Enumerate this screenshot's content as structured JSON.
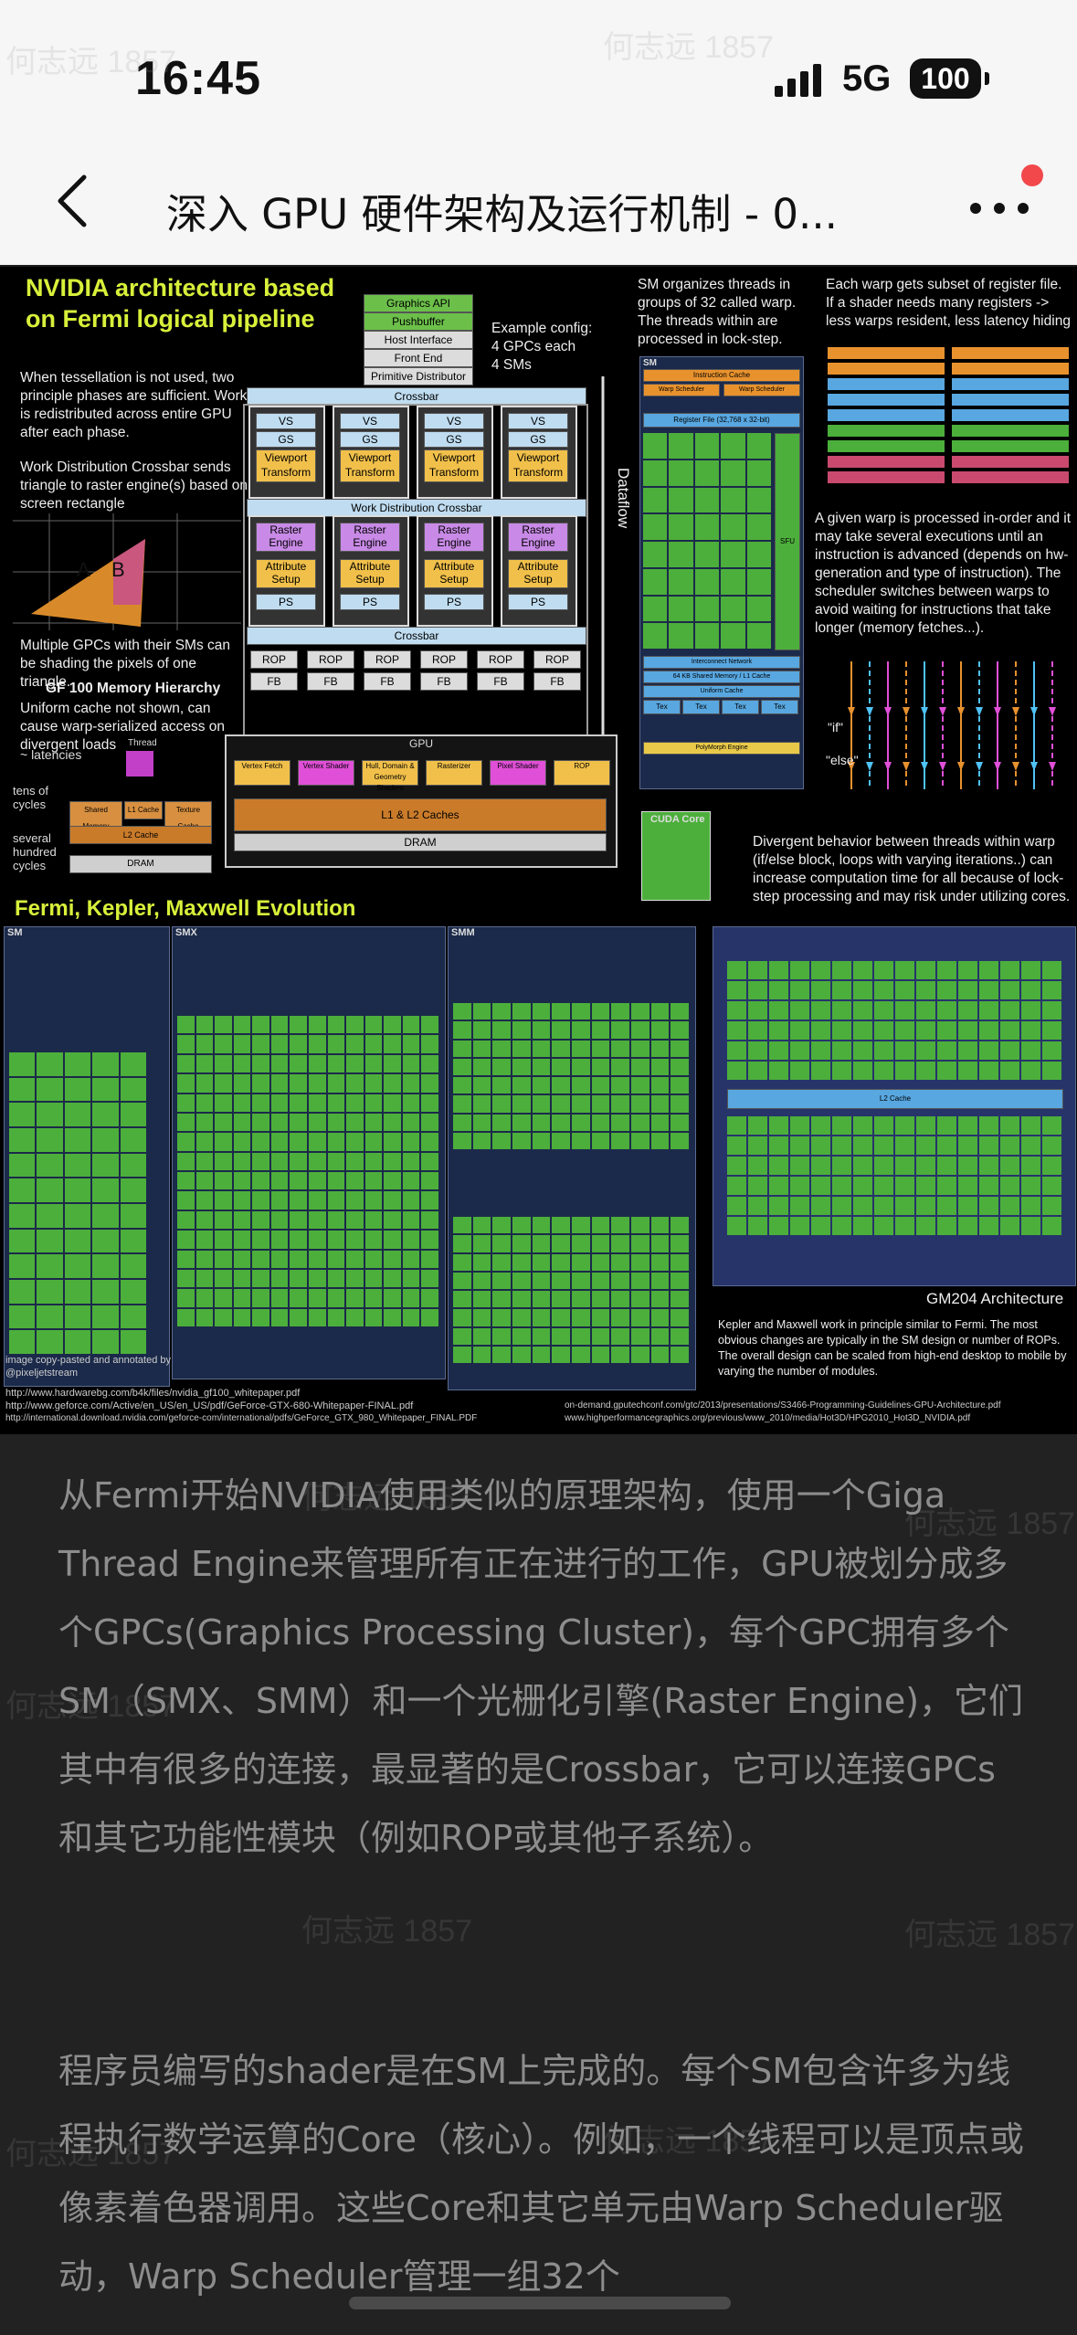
{
  "status_bar": {
    "time": "16:45",
    "network": "5G",
    "battery": "100"
  },
  "nav": {
    "title": "深入 GPU 硬件架构及运行机制 - 0..."
  },
  "figure": {
    "heading": "NVIDIA architecture based on Fermi logical pipeline",
    "pipeline_stages": [
      "Graphics API",
      "Pushbuffer",
      "Host Interface",
      "Front End",
      "Primitive Distributor"
    ],
    "example_config": "Example config:\n4 GPCs each\n4 SMs",
    "crossbar": "Crossbar",
    "work_distribution_crossbar": "Work Distribution Crossbar",
    "dataflow": "Dataflow",
    "gpc_rows": [
      "VS",
      "GS",
      "Viewport Transform"
    ],
    "raster_rows": [
      "Raster Engine",
      "Attribute Setup",
      "PS"
    ],
    "rop": "ROP",
    "fb": "FB",
    "left_text_1": "When tessellation is not used, two principle phases are sufficient. Work is redistributed across entire GPU after each phase.",
    "left_text_2": "Work Distribution Crossbar sends triangle to raster engine(s) based on screen rectangle",
    "triangle_a": "A",
    "triangle_b": "B",
    "left_text_3": "Multiple GPCs with their SMs can be shading the pixels of one triangle.",
    "memory_title": "GF 100 Memory Hierarchy",
    "memory_text": "Uniform cache not shown, can cause warp-serialized access on divergent loads",
    "latencies": "~ latencies",
    "tens": "tens of cycles",
    "several": "several hundred cycles",
    "thread": "Thread",
    "shared_mem": "Shared Memory",
    "l1": "L1 Cache",
    "tex": "Texture Cache",
    "l2": "L2 Cache",
    "dram": "DRAM",
    "gpu": "GPU",
    "gpu_stages": [
      "Vertex Fetch",
      "Vertex Shader",
      "Hull, Domain & Geometry Shaders",
      "Rasterizer",
      "Pixel Shader",
      "ROP"
    ],
    "l1l2": "L1 & L2 Caches",
    "sm_text": "SM organizes threads in groups of 32 called warp. The threads within are processed in lock-step.",
    "sm_label": "SM",
    "instruction_cache": "Instruction Cache",
    "warp_scheduler": "Warp Scheduler",
    "dispatch_unit": "Dispatch Unit",
    "register_file": "Register File (32,768 x 32-bit)",
    "core": "Core",
    "ldst": "LD/ST",
    "sfu": "SFU",
    "interconnect": "Interconnect Network",
    "shared_l1": "64 KB Shared Memory / L1 Cache",
    "uniform_cache": "Uniform Cache",
    "tex_unit": "Tex",
    "polymorph": "PolyMorph Engine",
    "warp_text": "Each warp gets subset of register file. If a shader needs many registers -> less warps resident, less latency hiding",
    "inorder_text": "A given warp is processed in-order and it may take several executions until an instruction is advanced (depends on hw-generation and type of instruction). The scheduler switches between warps to avoid waiting for instructions that take longer (memory fetches...).",
    "if_label": "\"if\"",
    "else_label": "\"else\"",
    "cuda_core": "CUDA Core",
    "divergent_text": "Divergent behavior between threads within warp (if/else block, loops with varying iterations..) can increase computation time for all because of lock-step processing and may risk under utilizing cores.",
    "evolution": "Fermi, Kepler, Maxwell Evolution",
    "smx": "SMX",
    "smm": "SMM",
    "gm204": "GM204 Architecture",
    "kepler_text": "Kepler and Maxwell work in principle similar to Fermi. The most obvious changes are typically in the SM design or number of ROPs. The overall design can be scaled from high-end desktop to mobile by varying the number of modules.",
    "credit": "image copy-pasted and annotated by @pixeljetstream",
    "url_1": "http://www.hardwarebg.com/b4k/files/nvidia_gf100_whitepaper.pdf",
    "url_2": "http://www.geforce.com/Active/en_US/en_US/pdf/GeForce-GTX-680-Whitepaper-FINAL.pdf",
    "url_3": "http://international.download.nvidia.com/geforce-com/international/pdfs/GeForce_GTX_980_Whitepaper_FINAL.PDF",
    "url_4": "on-demand.gputechconf.com/gtc/2013/presentations/S3466-Programming-Guidelines-GPU-Architecture.pdf",
    "url_5": "www.highperformancegraphics.org/previous/www_2010/media/Hot3D/HPG2010_Hot3D_NVIDIA.pdf"
  },
  "article": {
    "p1": "从Fermi开始NVIDIA使用类似的原理架构，使用一个Giga Thread Engine来管理所有正在进行的工作，GPU被划分成多个GPCs(Graphics Processing Cluster)，每个GPC拥有多个SM（SMX、SMM）和一个光栅化引擎(Raster Engine)，它们其中有很多的连接，最显著的是Crossbar，它可以连接GPCs和其它功能性模块（例如ROP或其他子系统）。",
    "p2": "程序员编写的shader是在SM上完成的。每个SM包含许多为线程执行数学运算的Core（核心）。例如，一个线程可以是顶点或像素着色器调用。这些Core和其它单元由Warp Scheduler驱动，Warp Scheduler管理一组32个"
  },
  "watermark": "何志远 1857"
}
